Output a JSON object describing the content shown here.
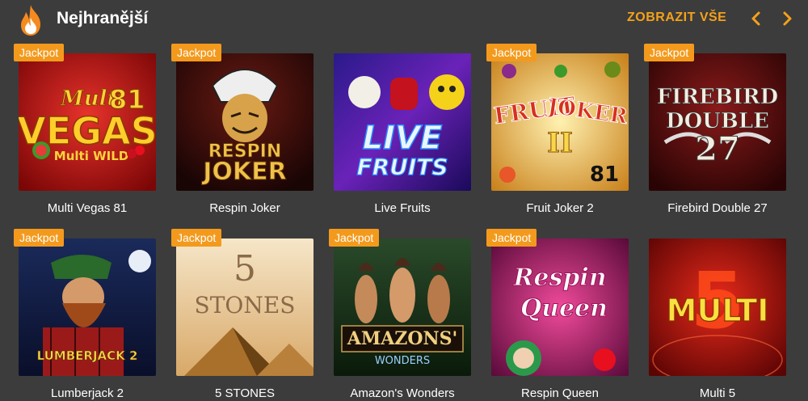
{
  "header": {
    "title": "Nejhranější",
    "show_all": "ZOBRAZIT VŠE",
    "icon": "flame-icon"
  },
  "colors": {
    "background": "#3c3c3c",
    "accent": "#f5a11a",
    "badge": "#f39a1d",
    "text": "#ffffff"
  },
  "badge_label": "Jackpot",
  "games": [
    {
      "name": "Multi Vegas 81",
      "jackpot": true,
      "art": {
        "line1": "Multi",
        "line2": "VEGAS",
        "line3": "81",
        "line4": "Multi WILD"
      }
    },
    {
      "name": "Respin Joker",
      "jackpot": true,
      "art": {
        "line1": "RESPIN",
        "line2": "JOKER"
      }
    },
    {
      "name": "Live Fruits",
      "jackpot": false,
      "art": {
        "line1": "LIVE",
        "line2": "FRUITS"
      }
    },
    {
      "name": "Fruit Joker 2",
      "jackpot": true,
      "art": {
        "line1": "FRUIT",
        "line2": "JOKER",
        "line3": "II",
        "line4": "81"
      }
    },
    {
      "name": "Firebird Double 27",
      "jackpot": true,
      "art": {
        "line1": "FIREBIRD",
        "line2": "DOUBLE",
        "line3": "27"
      }
    },
    {
      "name": "Lumberjack 2",
      "jackpot": true,
      "art": {
        "line1": "LUMBERJACK 2"
      }
    },
    {
      "name": "5 STONES",
      "jackpot": true,
      "art": {
        "line1": "5",
        "line2": "STONES"
      }
    },
    {
      "name": "Amazon's Wonders",
      "jackpot": true,
      "art": {
        "line1": "AMAZONS'",
        "line2": "WONDERS"
      }
    },
    {
      "name": "Respin Queen",
      "jackpot": true,
      "art": {
        "line1": "Respin",
        "line2": "Queen"
      }
    },
    {
      "name": "Multi 5",
      "jackpot": false,
      "art": {
        "line1": "5",
        "line2": "MULTI"
      }
    }
  ]
}
